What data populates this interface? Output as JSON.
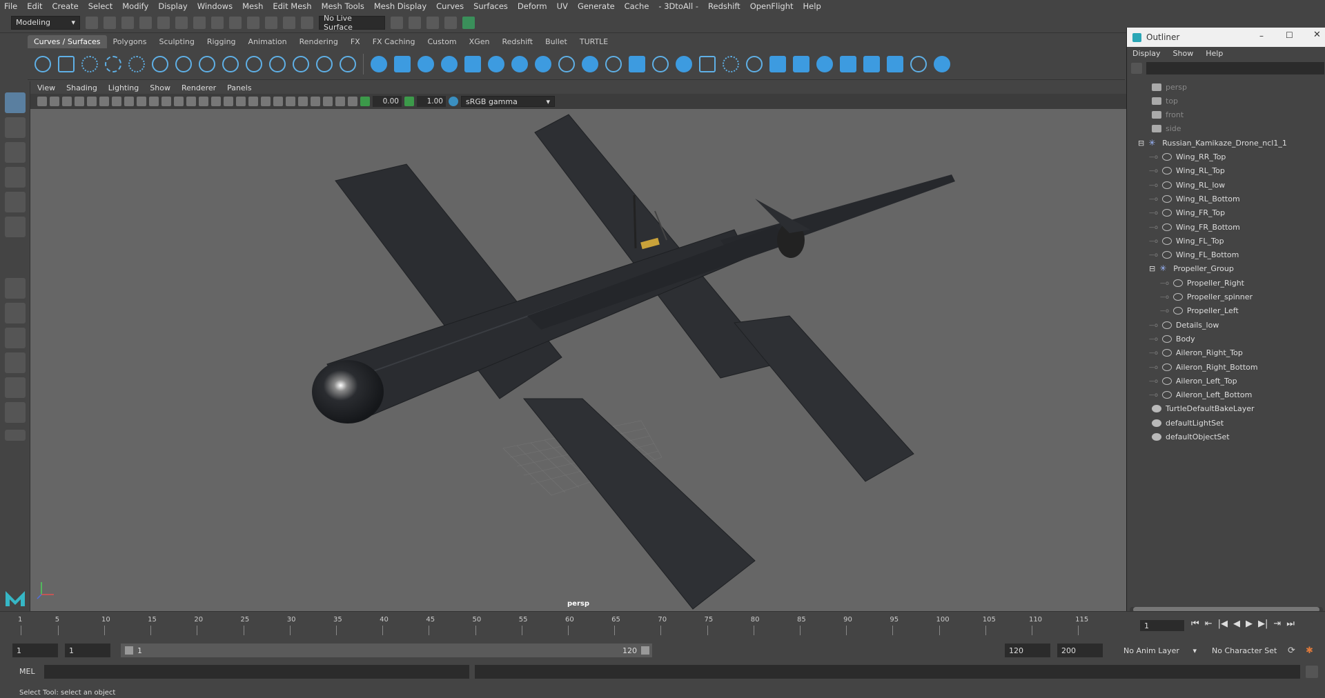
{
  "menubar": {
    "items": [
      "File",
      "Edit",
      "Create",
      "Select",
      "Modify",
      "Display",
      "Windows",
      "Mesh",
      "Edit Mesh",
      "Mesh Tools",
      "Mesh Display",
      "Curves",
      "Surfaces",
      "Deform",
      "UV",
      "Generate",
      "Cache",
      "- 3DtoAll -",
      "Redshift",
      "OpenFlight",
      "Help"
    ]
  },
  "status": {
    "mode": "Modeling",
    "live_surface": "No Live Surface"
  },
  "shelf": {
    "tabs": [
      "Curves / Surfaces",
      "Polygons",
      "Sculpting",
      "Rigging",
      "Animation",
      "Rendering",
      "FX",
      "FX Caching",
      "Custom",
      "XGen",
      "Redshift",
      "Bullet",
      "TURTLE"
    ],
    "active": 0
  },
  "viewport": {
    "menu": [
      "View",
      "Shading",
      "Lighting",
      "Show",
      "Renderer",
      "Panels"
    ],
    "exposure": "0.00",
    "gamma": "1.00",
    "colorspace": "sRGB gamma",
    "camera_label": "persp"
  },
  "outliner": {
    "title": "Outliner",
    "menu": [
      "Display",
      "Show",
      "Help"
    ],
    "items": [
      {
        "label": "persp",
        "type": "cam",
        "depth": 0,
        "dim": true
      },
      {
        "label": "top",
        "type": "cam",
        "depth": 0,
        "dim": true
      },
      {
        "label": "front",
        "type": "cam",
        "depth": 0,
        "dim": true
      },
      {
        "label": "side",
        "type": "cam",
        "depth": 0,
        "dim": true
      },
      {
        "label": "Russian_Kamikaze_Drone_ncl1_1",
        "type": "grp",
        "depth": 0,
        "expander": "−"
      },
      {
        "label": "Wing_RR_Top",
        "type": "mesh",
        "depth": 1
      },
      {
        "label": "Wing_RL_Top",
        "type": "mesh",
        "depth": 1
      },
      {
        "label": "Wing_RL_low",
        "type": "mesh",
        "depth": 1
      },
      {
        "label": "Wing_RL_Bottom",
        "type": "mesh",
        "depth": 1
      },
      {
        "label": "Wing_FR_Top",
        "type": "mesh",
        "depth": 1
      },
      {
        "label": "Wing_FR_Bottom",
        "type": "mesh",
        "depth": 1
      },
      {
        "label": "Wing_FL_Top",
        "type": "mesh",
        "depth": 1
      },
      {
        "label": "Wing_FL_Bottom",
        "type": "mesh",
        "depth": 1
      },
      {
        "label": "Propeller_Group",
        "type": "grp",
        "depth": 1,
        "expander": "−"
      },
      {
        "label": "Propeller_Right",
        "type": "mesh",
        "depth": 2
      },
      {
        "label": "Propeller_spinner",
        "type": "mesh",
        "depth": 2
      },
      {
        "label": "Propeller_Left",
        "type": "mesh",
        "depth": 2
      },
      {
        "label": "Details_low",
        "type": "mesh",
        "depth": 1
      },
      {
        "label": "Body",
        "type": "mesh",
        "depth": 1
      },
      {
        "label": "Aileron_Right_Top",
        "type": "mesh",
        "depth": 1
      },
      {
        "label": "Aileron_Right_Bottom",
        "type": "mesh",
        "depth": 1
      },
      {
        "label": "Aileron_Left_Top",
        "type": "mesh",
        "depth": 1
      },
      {
        "label": "Aileron_Left_Bottom",
        "type": "mesh",
        "depth": 1
      },
      {
        "label": "TurtleDefaultBakeLayer",
        "type": "set",
        "depth": 0
      },
      {
        "label": "defaultLightSet",
        "type": "set",
        "depth": 0
      },
      {
        "label": "defaultObjectSet",
        "type": "set",
        "depth": 0
      }
    ]
  },
  "timeline": {
    "ticks": [
      "1",
      "5",
      "10",
      "15",
      "20",
      "25",
      "30",
      "35",
      "40",
      "45",
      "50",
      "55",
      "60",
      "65",
      "70",
      "75",
      "80",
      "85",
      "90",
      "95",
      "100",
      "105",
      "110",
      "115"
    ],
    "current": "1"
  },
  "range": {
    "start": "1",
    "playback_start": "1",
    "slider_start": "1",
    "slider_end": "120",
    "playback_end": "120",
    "end": "200",
    "anim_layer": "No Anim Layer",
    "char_set": "No Character Set"
  },
  "cmd": {
    "lang": "MEL"
  },
  "help": {
    "text": "Select Tool: select an object"
  }
}
